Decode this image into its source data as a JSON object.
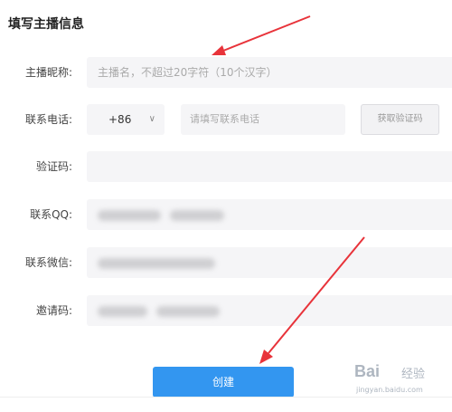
{
  "page": {
    "title": "填写主播信息"
  },
  "form": {
    "nickname": {
      "label": "主播昵称:",
      "placeholder": "主播名，不超过20字符（10个汉字）"
    },
    "phone": {
      "label": "联系电话:",
      "country_code": "+86",
      "placeholder": "请填写联系电话",
      "get_code_button": "获取验证码"
    },
    "verify_code": {
      "label": "验证码:"
    },
    "qq": {
      "label": "联系QQ:"
    },
    "wechat": {
      "label": "联系微信:"
    },
    "invite_code": {
      "label": "邀请码:"
    },
    "submit_label": "创建"
  },
  "annotations": {
    "arrow_color": "#e8333a"
  },
  "watermark": {
    "logo": "Bai",
    "text": "经验",
    "url": "jingyan.baidu.com"
  }
}
